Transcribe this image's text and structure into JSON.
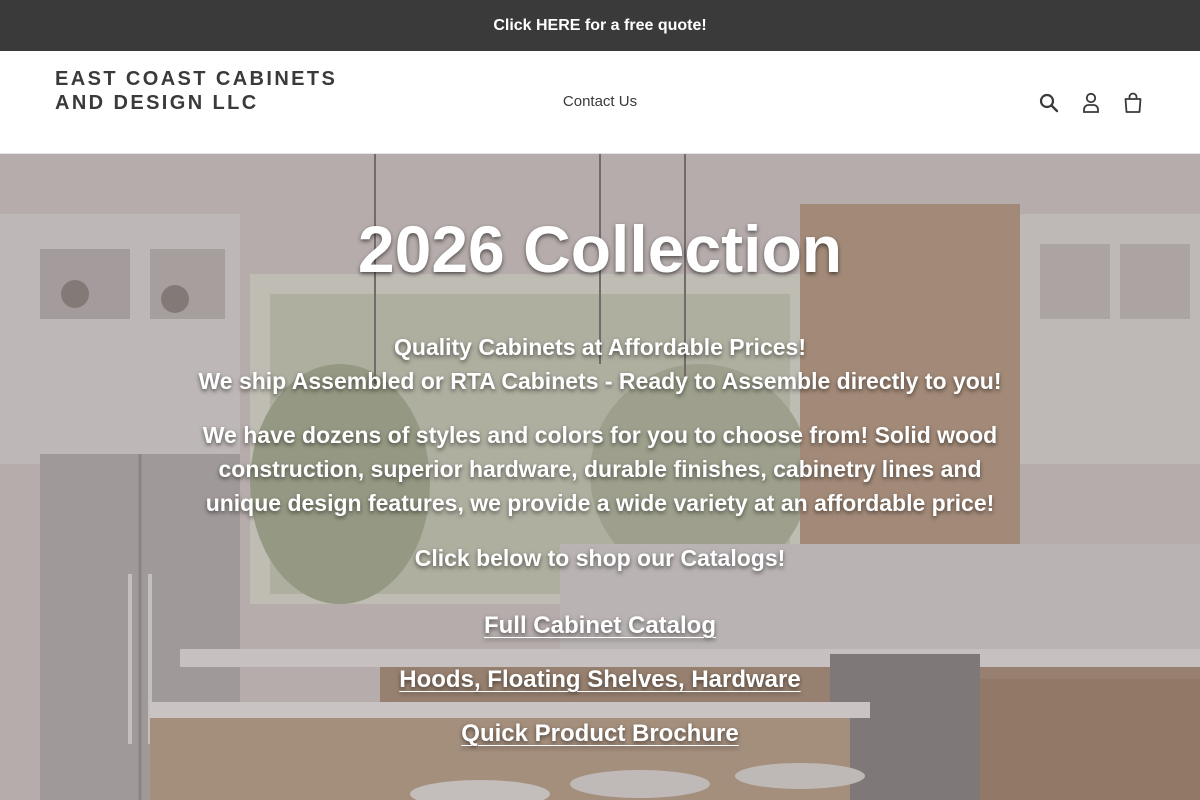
{
  "announcement": {
    "text": "Click HERE for a free quote!"
  },
  "header": {
    "logo": "EAST COAST CABINETS AND DESIGN LLC",
    "nav": [
      {
        "label": "Contact Us"
      }
    ],
    "icons": [
      "search-icon",
      "account-icon",
      "cart-icon"
    ]
  },
  "hero": {
    "title": "2026 Collection",
    "line1": "Quality Cabinets at Affordable Prices!",
    "line2": "We ship Assembled or RTA Cabinets - Ready to Assemble directly to you!",
    "paragraph": "We have dozens of styles and colors for you to choose from! Solid wood construction, superior hardware, durable finishes, cabinetry lines and unique design features, we provide a wide variety at an affordable price!",
    "cta": "Click below to shop our Catalogs!",
    "links": [
      {
        "label": "Full Cabinet Catalog"
      },
      {
        "label": "Hoods, Floating Shelves, Hardware"
      },
      {
        "label": "Quick Product Brochure"
      }
    ]
  },
  "colors": {
    "announcement_bg": "#3a3a3a",
    "text_dark": "#3a3a3a",
    "hero_text": "#ffffff"
  }
}
